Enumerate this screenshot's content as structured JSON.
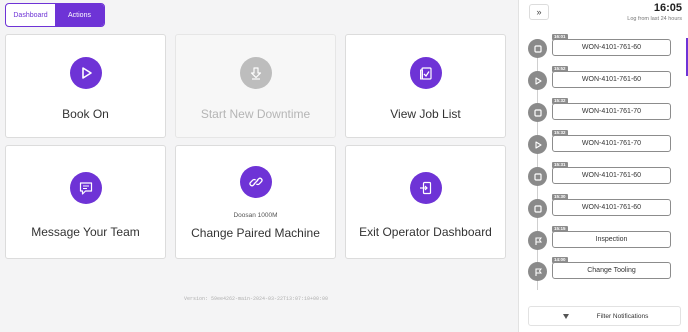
{
  "tabs": [
    {
      "label": "Dashboard",
      "active": false
    },
    {
      "label": "Actions",
      "active": true
    }
  ],
  "cards": {
    "book_on": {
      "label": "Book On",
      "icon": "play-icon"
    },
    "start_downtime": {
      "label": "Start New Downtime",
      "icon": "download-icon",
      "disabled": true
    },
    "view_job_list": {
      "label": "View Job List",
      "icon": "clipboard-check-icon"
    },
    "message_team": {
      "label": "Message Your Team",
      "icon": "chat-icon"
    },
    "change_machine": {
      "label": "Change Paired Machine",
      "sublabel": "Doosan 1000M",
      "icon": "link-icon"
    },
    "exit_dashboard": {
      "label": "Exit Operator Dashboard",
      "icon": "exit-icon"
    }
  },
  "version": "Version: 59ee4262-main-2024-03-22T13:07:10+00:00",
  "panel": {
    "time": "16:05",
    "subtitle": "Log from last 24 hours",
    "entries": [
      {
        "time": "16:01",
        "label": "WON-4101-761-60",
        "icon": "stop-icon"
      },
      {
        "time": "15:52",
        "label": "WON-4101-761-60",
        "icon": "play-icon"
      },
      {
        "time": "15:32",
        "label": "WON-4101-761-70",
        "icon": "stop-icon"
      },
      {
        "time": "15:32",
        "label": "WON-4101-761-70",
        "icon": "play-icon"
      },
      {
        "time": "15:31",
        "label": "WON-4101-761-60",
        "icon": "stop-icon"
      },
      {
        "time": "15:30",
        "label": "WON-4101-761-60",
        "icon": "stop-icon"
      },
      {
        "time": "15:15",
        "label": "Inspection",
        "icon": "flag-icon"
      },
      {
        "time": "14:00",
        "label": "Change Tooling",
        "icon": "flag-icon"
      }
    ],
    "filter_label": "Filter Notifications"
  },
  "colors": {
    "accent": "#6e33d6",
    "disabled": "#bdbdbd",
    "timeline_grey": "#8c8c8c"
  }
}
